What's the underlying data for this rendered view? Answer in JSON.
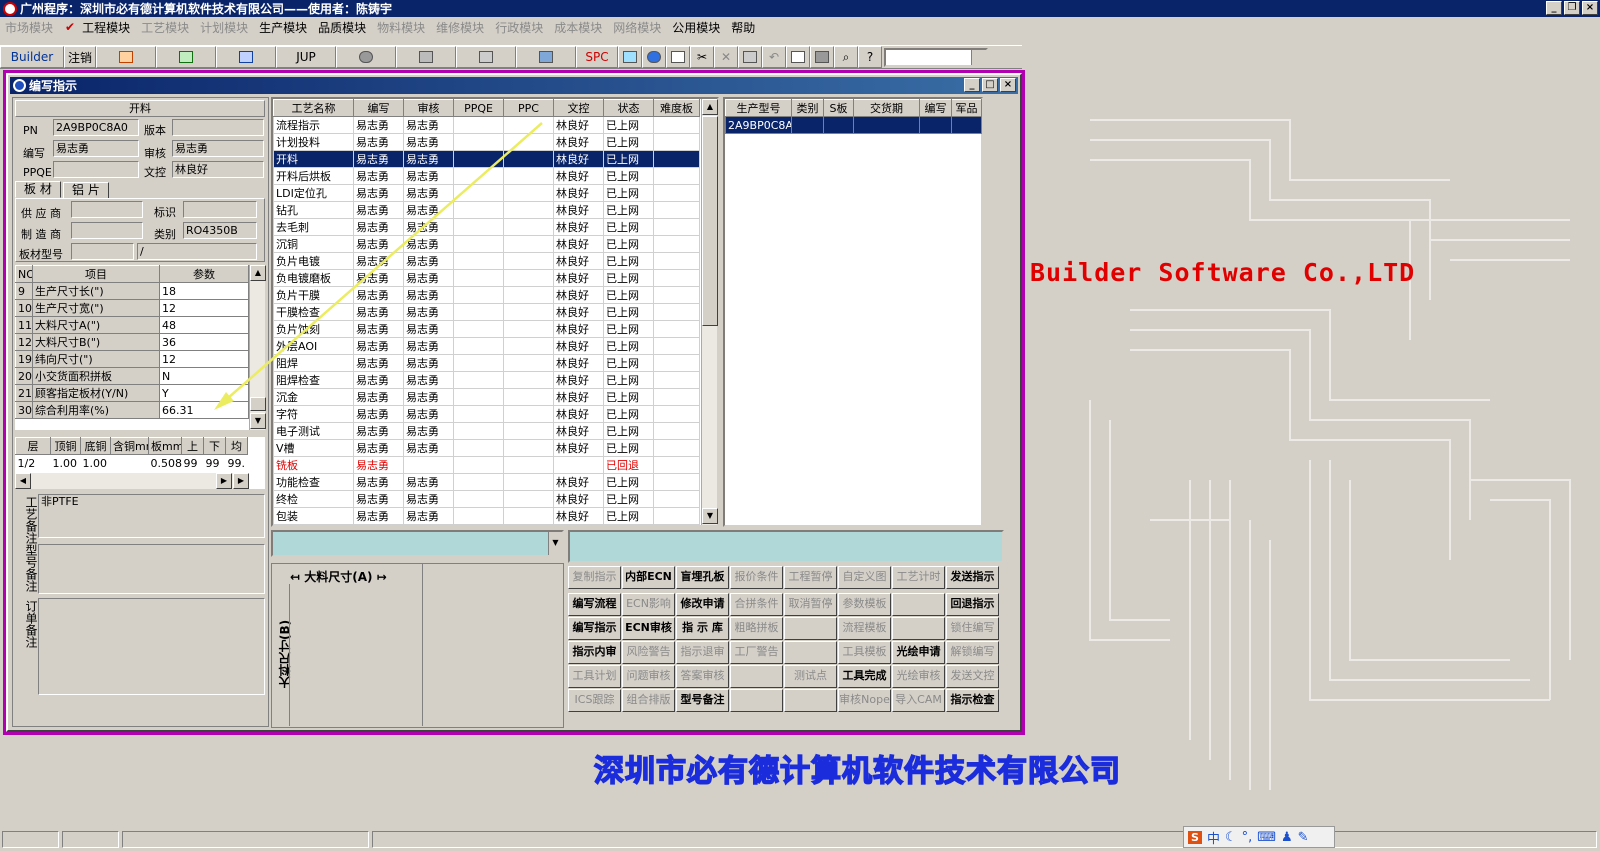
{
  "app": {
    "title": "广州程序：深圳市必有德计算机软件技术有限公司——使用者：陈铸宇"
  },
  "menu": [
    {
      "label": "市场模块",
      "enabled": false
    },
    {
      "label": "工程模块",
      "enabled": true,
      "checked": true
    },
    {
      "label": "工艺模块",
      "enabled": false
    },
    {
      "label": "计划模块",
      "enabled": false
    },
    {
      "label": "生产模块",
      "enabled": true
    },
    {
      "label": "品质模块",
      "enabled": true
    },
    {
      "label": "物料模块",
      "enabled": false
    },
    {
      "label": "维修模块",
      "enabled": false
    },
    {
      "label": "行政模块",
      "enabled": false
    },
    {
      "label": "成本模块",
      "enabled": false
    },
    {
      "label": "网络模块",
      "enabled": false
    },
    {
      "label": "公用模块",
      "enabled": true
    },
    {
      "label": "帮助",
      "enabled": true
    }
  ],
  "toolbar": {
    "builder": "Builder",
    "logout": "注销",
    "jup": "JUP",
    "spc": "SPC"
  },
  "window": {
    "title": "编写指示"
  },
  "header_panel": {
    "title": "开料",
    "pn_label": "PN",
    "pn": "2A9BP0C8A0",
    "version_label": "版本",
    "version": "",
    "writer_label": "编写",
    "writer": "易志勇",
    "review_label": "审核",
    "reviewer": "易志勇",
    "ppqe_label": "PPQE",
    "ppqe": "",
    "doc_label": "文控",
    "doc": "林良好"
  },
  "material_tabs": [
    "板 材",
    "铝 片"
  ],
  "material": {
    "supplier_label": "供 应 商",
    "supplier": "",
    "mark_label": "标识",
    "mark": "",
    "maker_label": "制 造 商",
    "maker": "",
    "type_label": "类别",
    "type": "RO4350B",
    "model_label": "板材型号",
    "model": "",
    "model2": "/"
  },
  "params": {
    "headers": [
      "NO",
      "项目",
      "参数"
    ],
    "rows": [
      [
        "9",
        "生产尺寸长(\")",
        "18"
      ],
      [
        "10",
        "生产尺寸宽(\")",
        "12"
      ],
      [
        "11",
        "大料尺寸A(\")",
        "48"
      ],
      [
        "12",
        "大料尺寸B(\")",
        "36"
      ],
      [
        "19",
        "纬向尺寸(\")",
        "12"
      ],
      [
        "20",
        "小交货面积拼板",
        "N"
      ],
      [
        "21",
        "顾客指定板材(Y/N)",
        "Y"
      ],
      [
        "30",
        "综合利用率(%)",
        "66.31"
      ]
    ]
  },
  "layers": {
    "headers": [
      "层",
      "顶铜",
      "底铜",
      "含铜mm",
      "板mm",
      "上",
      "下",
      "均"
    ],
    "rows": [
      [
        "1/2",
        "1.00",
        "1.00",
        "",
        "0.508",
        "99",
        "99",
        "99."
      ]
    ]
  },
  "notes": {
    "process_label": "工艺备注",
    "process": "非PTFE",
    "model_label": "型号备注",
    "model": "",
    "order_label": "订单备注",
    "order": ""
  },
  "process_table": {
    "headers": [
      "工艺名称",
      "编写",
      "审核",
      "PPQE",
      "PPC",
      "文控",
      "状态",
      "难度板"
    ],
    "rows": [
      [
        "流程指示",
        "易志勇",
        "易志勇",
        "",
        "",
        "林良好",
        "已上网",
        ""
      ],
      [
        "计划投料",
        "易志勇",
        "易志勇",
        "",
        "",
        "林良好",
        "已上网",
        ""
      ],
      [
        "开料",
        "易志勇",
        "易志勇",
        "",
        "",
        "林良好",
        "已上网",
        ""
      ],
      [
        "开料后烘板",
        "易志勇",
        "易志勇",
        "",
        "",
        "林良好",
        "已上网",
        ""
      ],
      [
        "LDI定位孔",
        "易志勇",
        "易志勇",
        "",
        "",
        "林良好",
        "已上网",
        ""
      ],
      [
        "钻孔",
        "易志勇",
        "易志勇",
        "",
        "",
        "林良好",
        "已上网",
        ""
      ],
      [
        "去毛刺",
        "易志勇",
        "易志勇",
        "",
        "",
        "林良好",
        "已上网",
        ""
      ],
      [
        "沉铜",
        "易志勇",
        "易志勇",
        "",
        "",
        "林良好",
        "已上网",
        ""
      ],
      [
        "负片电镀",
        "易志勇",
        "易志勇",
        "",
        "",
        "林良好",
        "已上网",
        ""
      ],
      [
        "负电镀磨板",
        "易志勇",
        "易志勇",
        "",
        "",
        "林良好",
        "已上网",
        ""
      ],
      [
        "负片干膜",
        "易志勇",
        "易志勇",
        "",
        "",
        "林良好",
        "已上网",
        ""
      ],
      [
        "干膜检查",
        "易志勇",
        "易志勇",
        "",
        "",
        "林良好",
        "已上网",
        ""
      ],
      [
        "负片蚀刻",
        "易志勇",
        "易志勇",
        "",
        "",
        "林良好",
        "已上网",
        ""
      ],
      [
        "外层AOI",
        "易志勇",
        "易志勇",
        "",
        "",
        "林良好",
        "已上网",
        ""
      ],
      [
        "阻焊",
        "易志勇",
        "易志勇",
        "",
        "",
        "林良好",
        "已上网",
        ""
      ],
      [
        "阻焊检查",
        "易志勇",
        "易志勇",
        "",
        "",
        "林良好",
        "已上网",
        ""
      ],
      [
        "沉金",
        "易志勇",
        "易志勇",
        "",
        "",
        "林良好",
        "已上网",
        ""
      ],
      [
        "字符",
        "易志勇",
        "易志勇",
        "",
        "",
        "林良好",
        "已上网",
        ""
      ],
      [
        "电子测试",
        "易志勇",
        "易志勇",
        "",
        "",
        "林良好",
        "已上网",
        ""
      ],
      [
        "V槽",
        "易志勇",
        "易志勇",
        "",
        "",
        "林良好",
        "已上网",
        ""
      ],
      [
        "铣板",
        "易志勇",
        "",
        "",
        "",
        "",
        "已回退",
        ""
      ],
      [
        "功能检查",
        "易志勇",
        "易志勇",
        "",
        "",
        "林良好",
        "已上网",
        ""
      ],
      [
        "终检",
        "易志勇",
        "易志勇",
        "",
        "",
        "林良好",
        "已上网",
        ""
      ],
      [
        "包装",
        "易志勇",
        "易志勇",
        "",
        "",
        "林良好",
        "已上网",
        ""
      ]
    ],
    "selected": 2,
    "reverted": 20
  },
  "model_table": {
    "headers": [
      "生产型号",
      "类别",
      "S板",
      "交货期",
      "编写",
      "军品"
    ],
    "rows": [
      [
        "2A9BP0C8A0",
        "",
        "",
        "",
        "",
        ""
      ]
    ]
  },
  "dimensions": {
    "a": "大料尺寸(A)",
    "b": "大料尺寸(B)"
  },
  "buttons": [
    [
      "复制指示",
      "内部ECN",
      "盲埋孔板",
      "报价条件",
      "工程暂停",
      "自定义图",
      "工艺计时",
      "发送指示"
    ],
    [
      "编写流程",
      "ECN影响",
      "修改申请",
      "合拼条件",
      "取消暂停",
      "参数模板",
      "",
      "回退指示"
    ],
    [
      "编写指示",
      "ECN审核",
      "指 示 库",
      "粗略拼板",
      "",
      "流程模板",
      "",
      "锁住编写"
    ],
    [
      "指示内审",
      "风险警告",
      "指示退审",
      "工厂警告",
      "",
      "工具模板",
      "光绘申请",
      "解锁编写"
    ],
    [
      "工具计划",
      "问题审核",
      "答案审核",
      "",
      "测试点",
      "工具完成",
      "光绘审核",
      "发送文控"
    ],
    [
      "ICS跟踪",
      "组合排版",
      "型号备注",
      "",
      "",
      "审核Nope",
      "导入CAM",
      "指示检查"
    ]
  ],
  "buttons_enabled": [
    [
      false,
      true,
      true,
      false,
      false,
      false,
      false,
      true
    ],
    [
      true,
      false,
      true,
      false,
      false,
      false,
      false,
      true
    ],
    [
      true,
      true,
      true,
      false,
      false,
      false,
      false,
      false
    ],
    [
      true,
      false,
      false,
      false,
      false,
      false,
      true,
      false
    ],
    [
      false,
      false,
      false,
      false,
      false,
      true,
      false,
      false
    ],
    [
      false,
      false,
      true,
      false,
      false,
      false,
      false,
      true
    ]
  ],
  "brand": {
    "en": "Builder Software Co.,LTD",
    "cn": "深圳市必有德计算机软件技术有限公司"
  },
  "ime": {
    "label": "中"
  },
  "colors": {
    "title": "#0a246a",
    "selected": "#0a246a",
    "reverted": "#e00000",
    "brand_en": "#e00000",
    "brand_cn": "#1a2cdc",
    "accent_outline": "#b000b0"
  }
}
